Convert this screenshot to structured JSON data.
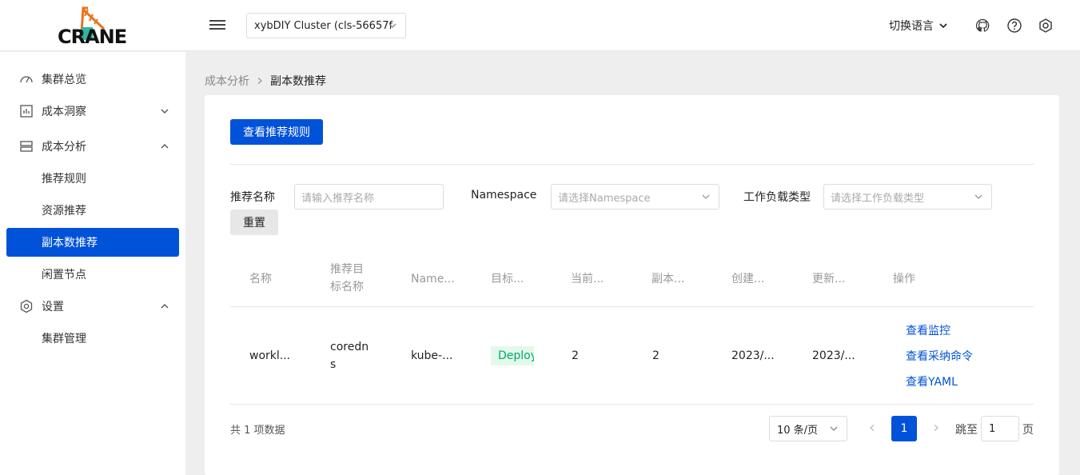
{
  "header": {
    "logo_text": "CRANE",
    "cluster_select_value": "xybDIY Cluster (cls-56657f",
    "language_label": "切换语言"
  },
  "sidebar": {
    "items": [
      {
        "label": "集群总览",
        "icon": "dashboard-icon"
      },
      {
        "label": "成本洞察",
        "icon": "chart-icon"
      },
      {
        "label": "成本分析",
        "icon": "layers-icon"
      },
      {
        "label": "推荐规则"
      },
      {
        "label": "资源推荐"
      },
      {
        "label": "副本数推荐"
      },
      {
        "label": "闲置节点"
      },
      {
        "label": "设置",
        "icon": "settings-icon"
      },
      {
        "label": "集群管理"
      }
    ]
  },
  "breadcrumb": {
    "parent": "成本分析",
    "current": "副本数推荐"
  },
  "toolbar": {
    "view_rules_label": "查看推荐规则"
  },
  "filters": {
    "name_label": "推荐名称",
    "name_placeholder": "请输入推荐名称",
    "namespace_label": "Namespace",
    "namespace_placeholder": "请选择Namespace",
    "workload_type_label": "工作负载类型",
    "workload_type_placeholder": "请选择工作负载类型",
    "reset_label": "重置"
  },
  "table": {
    "columns": [
      "名称",
      "推荐目标名称",
      "Name...",
      "目标...",
      "当前...",
      "副本...",
      "创建...",
      "更新...",
      "操作"
    ],
    "rows": [
      {
        "name": "workl...",
        "target_name": "coredns",
        "namespace": "kube-...",
        "target_type": "Deploy",
        "current": "2",
        "replicas": "2",
        "created": "2023/...",
        "updated": "2023/...",
        "actions": [
          "查看监控",
          "查看采纳命令",
          "查看YAML"
        ]
      }
    ]
  },
  "pagination": {
    "total_text": "共 1 项数据",
    "page_size": "10 条/页",
    "current_page": "1",
    "jump_label": "跳至",
    "jump_value": "1",
    "page_suffix": "页"
  },
  "colors": {
    "primary": "#0052d9",
    "tag_bg": "#e3f9e9",
    "tag_text": "#00a870"
  }
}
